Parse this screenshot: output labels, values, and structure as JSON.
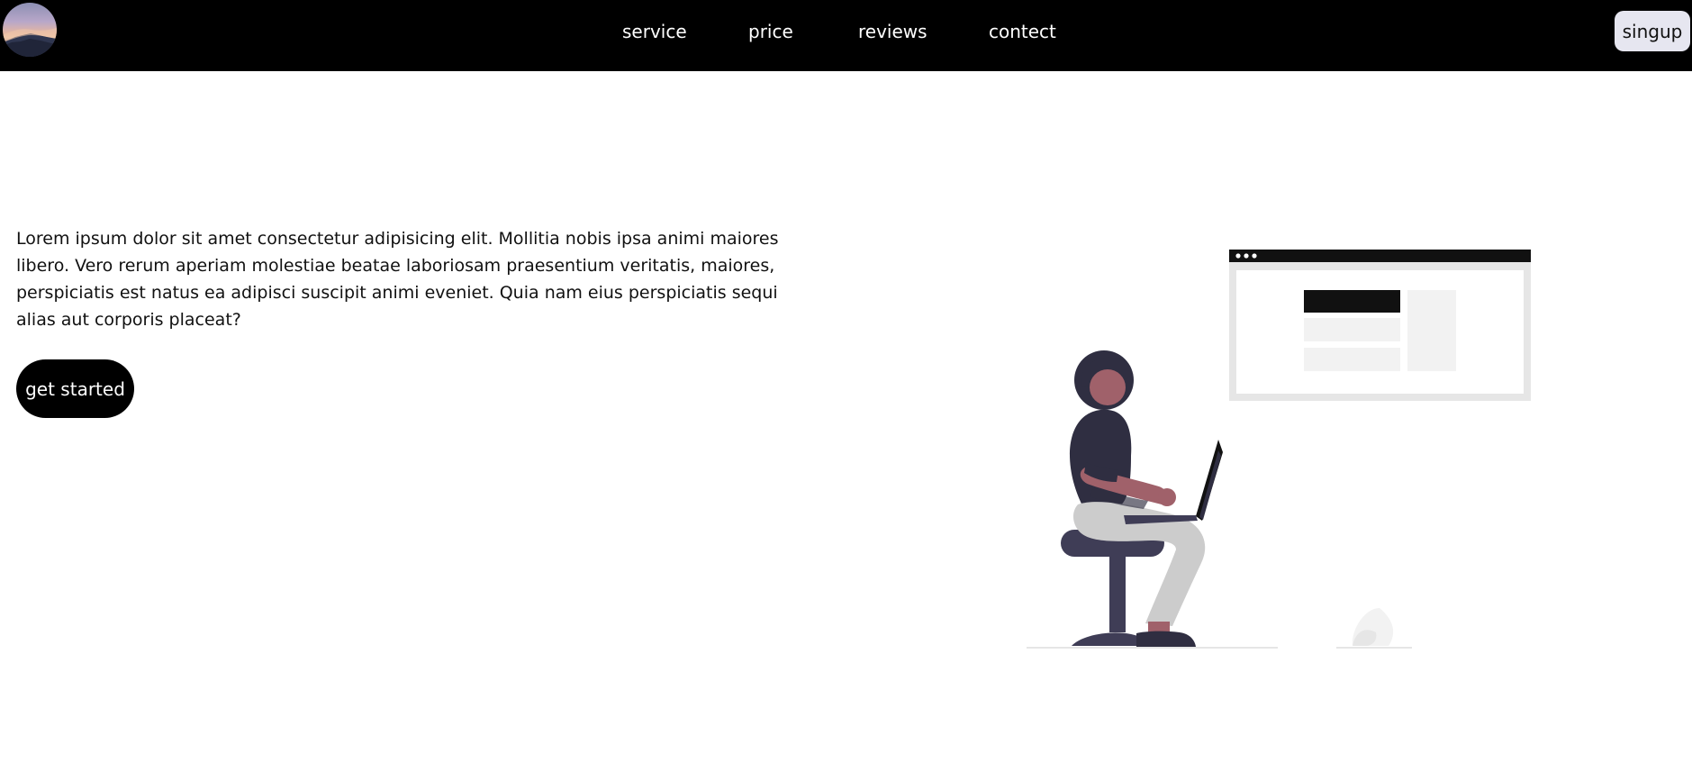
{
  "header": {
    "nav": {
      "service": "service",
      "price": "price",
      "reviews": "reviews",
      "contect": "contect"
    },
    "signup_label": "singup",
    "logo_icon": "avatar-logo"
  },
  "hero": {
    "text": "Lorem ipsum dolor sit amet consectetur adipisicing elit. Mollitia nobis ipsa animi maiores libero. Vero rerum aperiam molestiae beatae laboriosam praesentium veritatis, maiores, perspiciatis est natus ea adipisci suscipit animi eveniet. Quia nam eius perspiciatis sequi alias aut corporis placeat?",
    "cta_label": "get started"
  },
  "colors": {
    "header_bg": "#000000",
    "signup_bg": "#e6e6f0",
    "cta_bg": "#000000",
    "illustration_primary": "#2f2e41",
    "illustration_accent": "#a0616a",
    "illustration_gray": "#e6e6e6"
  }
}
